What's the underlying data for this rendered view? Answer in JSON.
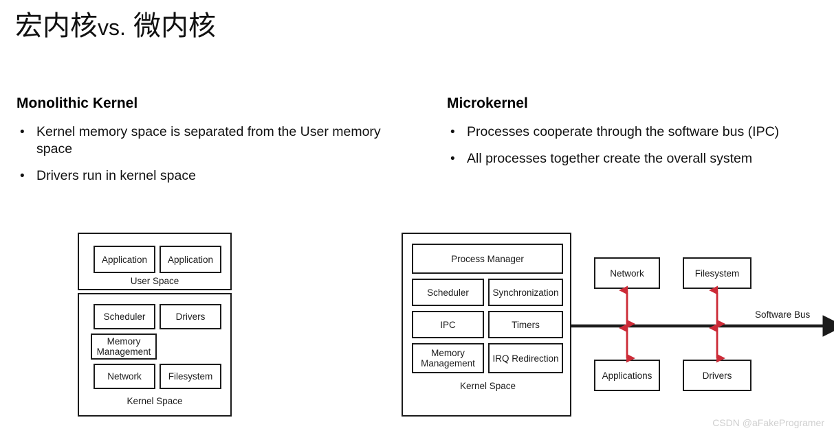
{
  "slide": {
    "title_main_1": "宏内核",
    "title_vs": "vs.",
    "title_main_2": "微内核",
    "title_full": "宏内核 vs. 微内核"
  },
  "columns": {
    "monolithic": {
      "heading": "Monolithic Kernel",
      "bullets": [
        "Kernel memory space is separated from the User memory space",
        "Drivers run in kernel space"
      ]
    },
    "microkernel": {
      "heading": "Microkernel",
      "bullets": [
        "Processes cooperate through the software bus (IPC)",
        "All processes together create the overall system"
      ]
    }
  },
  "monolithic_diagram": {
    "user_space_label": "User Space",
    "kernel_space_label": "Kernel Space",
    "user_boxes": [
      "Application",
      "Application"
    ],
    "kernel_boxes": {
      "scheduler": "Scheduler",
      "drivers": "Drivers",
      "memory_management": "Memory Management",
      "network": "Network",
      "filesystem": "Filesystem"
    }
  },
  "microkernel_diagram": {
    "kernel_space_label": "Kernel Space",
    "kernel_boxes": {
      "process_manager": "Process Manager",
      "scheduler": "Scheduler",
      "synchronization": "Synchronization",
      "ipc": "IPC",
      "timers": "Timers",
      "memory_management": "Memory Management",
      "irq_redirection": "IRQ Redirection"
    },
    "satellite_boxes": {
      "network": "Network",
      "filesystem": "Filesystem",
      "applications": "Applications",
      "drivers": "Drivers"
    },
    "bus_label": "Software Bus"
  },
  "watermark": {
    "text": "CSDN @aFakeProgramer"
  },
  "colors": {
    "text": "#111111",
    "stroke": "#1b1b1b",
    "arrow_red": "#cc2b37",
    "watermark": "#cfcfcf",
    "background": "#ffffff"
  }
}
